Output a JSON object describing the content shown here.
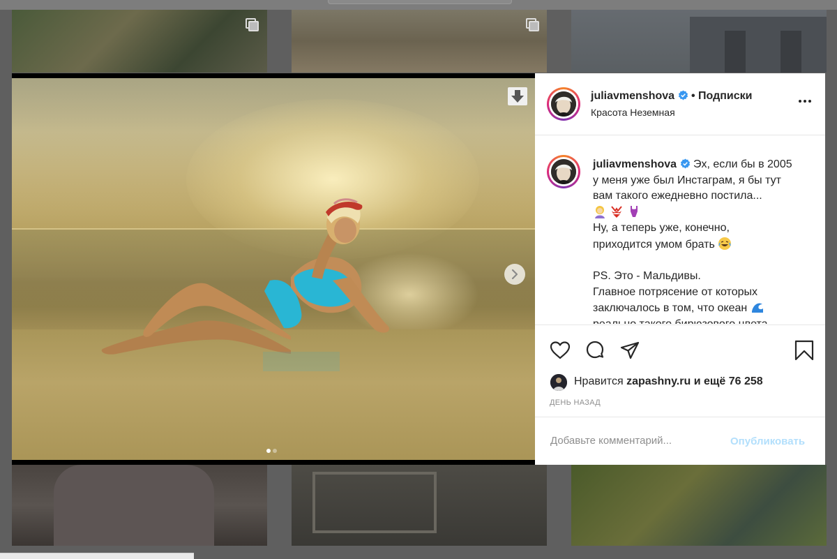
{
  "post": {
    "username": "juliavmenshova",
    "follow_label": "• Подписки",
    "location": "Красота Неземная",
    "caption": {
      "username": "juliavmenshova",
      "line1": "Эх, если бы в 2005",
      "line2": "у меня уже был Инстаграм, я бы тут",
      "line3": "вам такого ежедневно постила...",
      "line4": "Ну, а теперь уже, конечно,",
      "line5": "приходится умом брать",
      "line6": "PS. Это - Мальдивы.",
      "line7": "Главное потрясение от которых",
      "line8": "заключалось в том, что океан",
      "line9": "реально такого бирюзового цвета."
    },
    "emojis": [
      "woman-blonde-emoji",
      "bikini-emoji",
      "swimsuit-emoji",
      "laughing-emoji",
      "wave-emoji"
    ],
    "likes": {
      "prefix": "Нравится",
      "user": "zapashny.ru",
      "suffix": "и ещё 76 258"
    },
    "timestamp": "ДЕНЬ НАЗАД",
    "carousel": {
      "total": 2,
      "active": 1
    }
  },
  "comment": {
    "placeholder": "Добавьте комментарий...",
    "publish_label": "Опубликовать"
  },
  "colors": {
    "verified": "#3897f0",
    "publish_disabled": "#b2dffc",
    "swimsuit": "#29b6d4"
  },
  "icons": [
    "download-icon",
    "chevron-right-icon",
    "more-options-icon",
    "heart-icon",
    "comment-icon",
    "share-icon",
    "bookmark-icon",
    "verified-badge-icon",
    "multiple-photos-icon"
  ]
}
